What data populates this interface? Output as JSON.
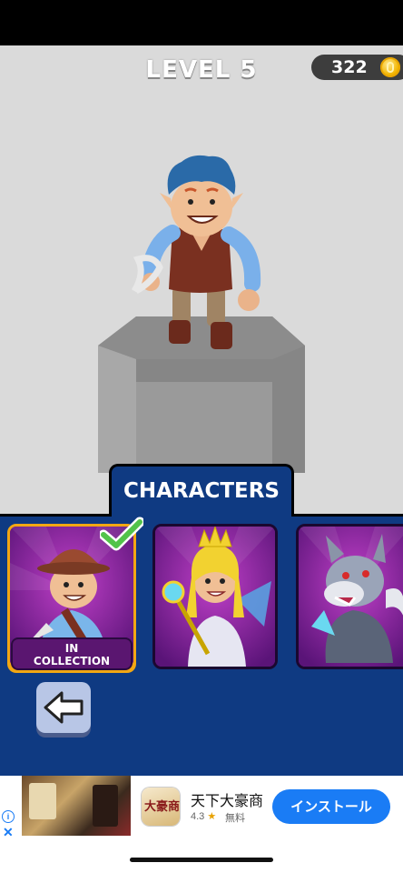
{
  "hud": {
    "level_label": "LEVEL 5",
    "coins": "322",
    "coin_icon": "gold-coin-icon"
  },
  "characters": {
    "tab_title": "CHARACTERS",
    "cards": [
      {
        "name": "adventurer",
        "status": "IN COLLECTION",
        "selected": true
      },
      {
        "name": "princess",
        "status": ""
      },
      {
        "name": "werewolf",
        "status": ""
      }
    ],
    "collection_label_line1": "IN",
    "collection_label_line2": "COLLECTION",
    "back_icon": "left-arrow-icon"
  },
  "ad": {
    "app_name": "天下大豪商",
    "icon_text": "大豪商",
    "rating": "4.3",
    "price": "無料",
    "cta": "インストール",
    "info_icon": "info-icon",
    "close_icon": "close-icon"
  },
  "colors": {
    "panel": "#0f3a82",
    "selected_border": "#f2a713",
    "card_bg": "#7a1a8c",
    "cta": "#1a7cf5"
  }
}
